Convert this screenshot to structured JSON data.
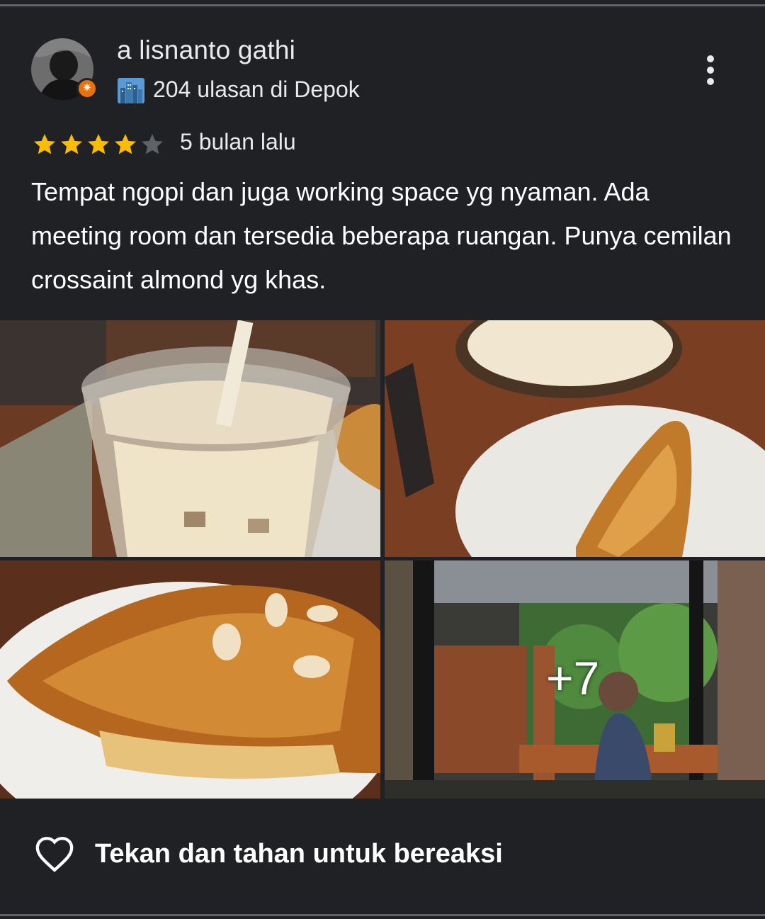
{
  "reviewer": {
    "name": "a lisnanto gathi",
    "reviews_summary": "204 ulasan di Depok",
    "badge_color": "#e8710a",
    "badge_icon": "local-guide-icon",
    "location_icon": "city-icon"
  },
  "review": {
    "rating": 4,
    "max_rating": 5,
    "time_ago": "5 bulan lalu",
    "text": "Tempat ngopi dan juga working space yg nyaman. Ada meeting room dan tersedia beberapa ruangan. Punya cemilan crossaint almond yg khas.",
    "star_color": "#fbbc04",
    "empty_star_color": "#5f6368"
  },
  "photos": {
    "items": [
      "iced-latte-photo",
      "latte-and-croissant-photo",
      "almond-croissant-photo",
      "cafe-entrance-photo"
    ],
    "more_count_label": "+7"
  },
  "actions": {
    "menu_icon": "more-vert-icon",
    "react_icon": "heart-outline-icon",
    "react_label": "Tekan dan tahan untuk bereaksi"
  }
}
